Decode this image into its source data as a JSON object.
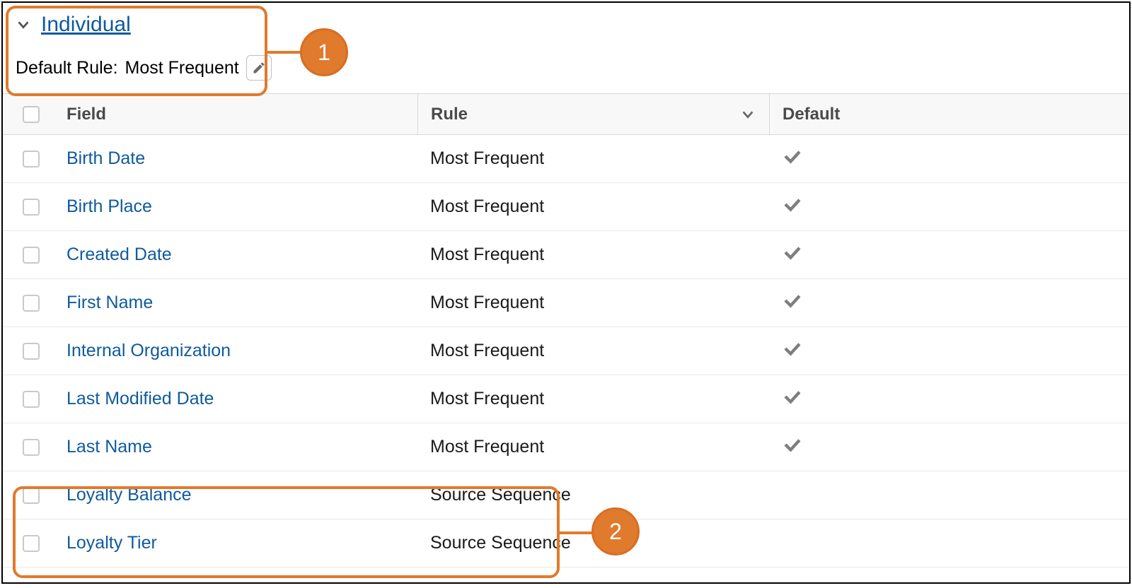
{
  "section": {
    "title": "Individual",
    "default_rule_label": "Default Rule:",
    "default_rule_value": "Most Frequent"
  },
  "table": {
    "headers": {
      "field": "Field",
      "rule": "Rule",
      "default": "Default"
    },
    "rows": [
      {
        "field": "Birth Date",
        "rule": "Most Frequent",
        "default": true
      },
      {
        "field": "Birth Place",
        "rule": "Most Frequent",
        "default": true
      },
      {
        "field": "Created Date",
        "rule": "Most Frequent",
        "default": true
      },
      {
        "field": "First Name",
        "rule": "Most Frequent",
        "default": true
      },
      {
        "field": "Internal Organization",
        "rule": "Most Frequent",
        "default": true
      },
      {
        "field": "Last Modified Date",
        "rule": "Most Frequent",
        "default": true
      },
      {
        "field": "Last Name",
        "rule": "Most Frequent",
        "default": true
      },
      {
        "field": "Loyalty Balance",
        "rule": "Source Sequence",
        "default": false
      },
      {
        "field": "Loyalty Tier",
        "rule": "Source Sequence",
        "default": false
      }
    ]
  },
  "callouts": {
    "one": "1",
    "two": "2"
  }
}
